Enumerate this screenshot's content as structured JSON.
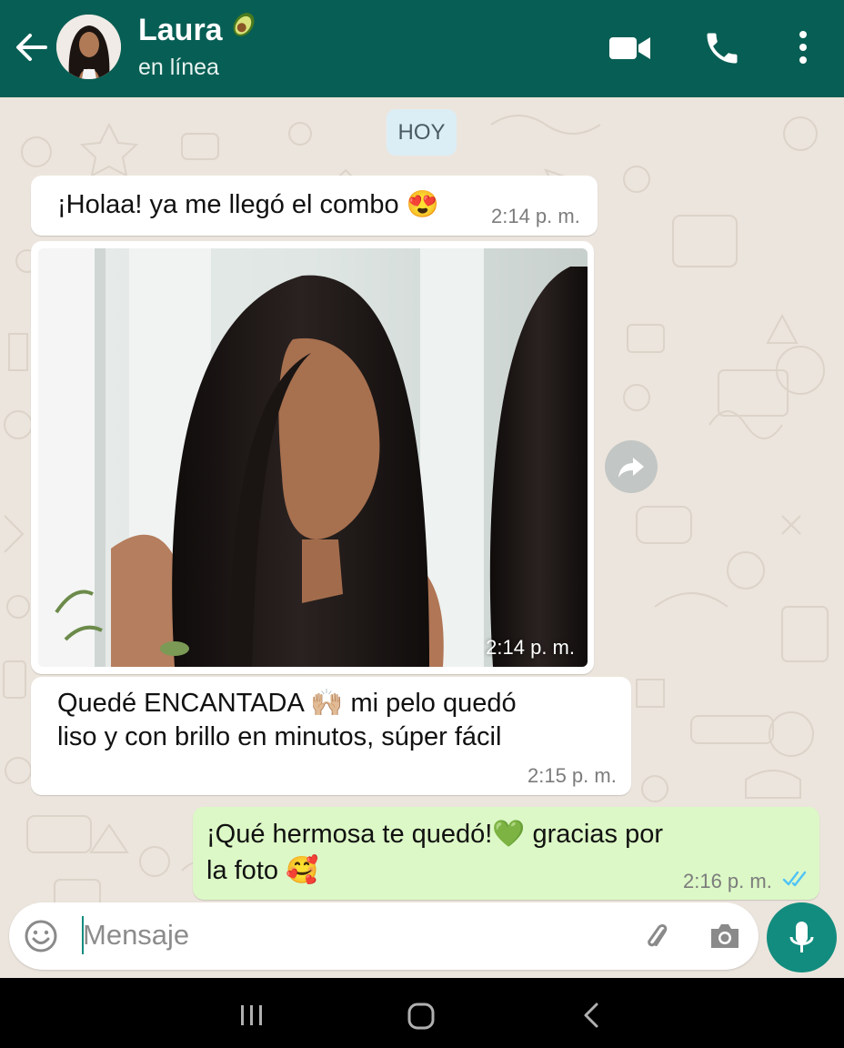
{
  "header": {
    "contact_name": "Laura",
    "name_emoji": "🥑",
    "status": "en línea",
    "icons": [
      "back-arrow-icon",
      "video-call-icon",
      "phone-call-icon",
      "more-options-icon"
    ],
    "color": "#075e54"
  },
  "chat": {
    "date_chip": "HOY",
    "messages": [
      {
        "direction": "incoming",
        "type": "text",
        "text": "¡Holaa! ya me llegó el combo 😍",
        "time": "2:14 p. m."
      },
      {
        "direction": "incoming",
        "type": "image",
        "time": "2:14 p. m."
      },
      {
        "direction": "incoming",
        "type": "text",
        "lines": [
          "Quedé ENCANTADA 🙌🏼 mi pelo quedó",
          "liso y con brillo en minutos, súper fácil"
        ],
        "time": "2:15 p. m."
      },
      {
        "direction": "outgoing",
        "type": "text",
        "lines": [
          "¡Qué hermosa te quedó!💚 gracias por",
          "la foto 🥰"
        ],
        "time": "2:16 p. m.",
        "read_receipt": "double-check-blue"
      }
    ],
    "incoming_color": "#ffffff",
    "outgoing_color": "#dcf8c6"
  },
  "composer": {
    "placeholder": "Mensaje",
    "value": "",
    "icons": [
      "emoji-icon",
      "attach-icon",
      "camera-icon",
      "mic-icon"
    ],
    "accent": "#128c7e"
  },
  "system_nav": {
    "icons": [
      "recent-apps-icon",
      "home-icon",
      "back-icon"
    ]
  }
}
